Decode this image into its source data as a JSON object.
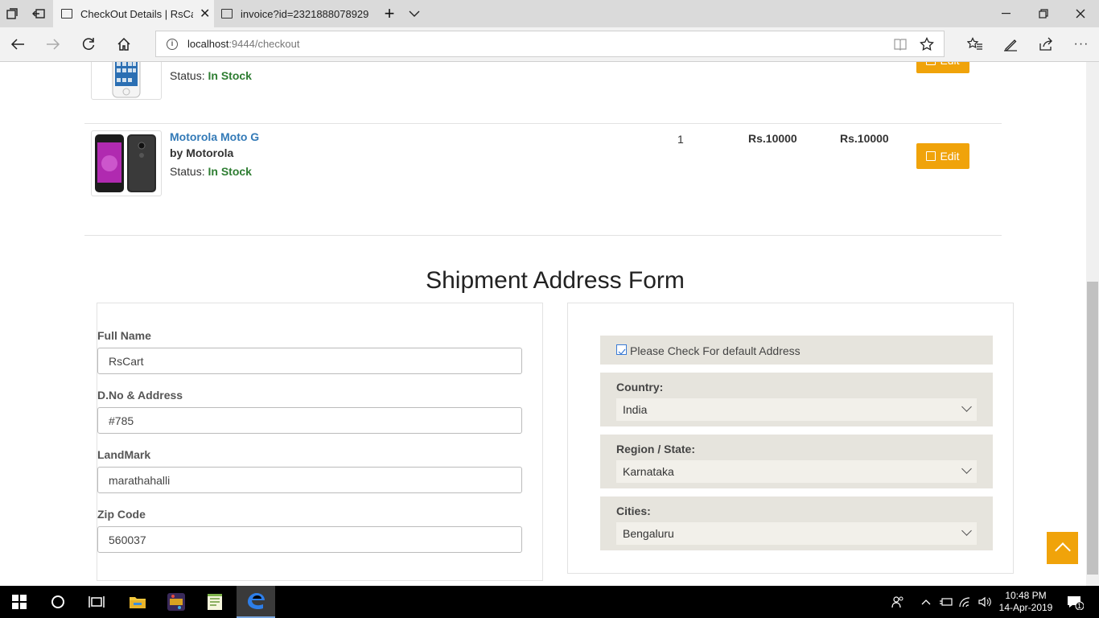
{
  "browser": {
    "tabs": [
      {
        "label": "CheckOut Details | RsCa",
        "active": true
      },
      {
        "label": "invoice?id=2321888078929",
        "active": false
      }
    ],
    "url_host": "localhost",
    "url_path": ":9444/checkout"
  },
  "products": [
    {
      "status_label": "Status:",
      "status_value": "In Stock"
    },
    {
      "name": "Motorola Moto G",
      "by": "by Motorola",
      "status_label": "Status:",
      "status_value": "In Stock",
      "qty": "1",
      "price": "Rs.10000",
      "total": "Rs.10000"
    }
  ],
  "edit_label": "Edit",
  "form": {
    "title": "Shipment Address Form",
    "full_name_label": "Full Name",
    "full_name_value": "RsCart",
    "address_label": "D.No & Address",
    "address_value": "#785",
    "landmark_label": "LandMark",
    "landmark_value": "marathahalli",
    "zip_label": "Zip Code",
    "zip_value": "560037",
    "default_check_label": "Please Check For default Address",
    "country_label": "Country:",
    "country_value": "India",
    "region_label": "Region / State:",
    "region_value": "Karnataka",
    "cities_label": "Cities:",
    "cities_value": "Bengaluru"
  },
  "taskbar": {
    "time": "10:48 PM",
    "date": "14-Apr-2019",
    "notification_count": "1"
  },
  "colors": {
    "accent": "#f0a30a",
    "link": "#337ab7",
    "in_stock": "#2e7d32"
  }
}
